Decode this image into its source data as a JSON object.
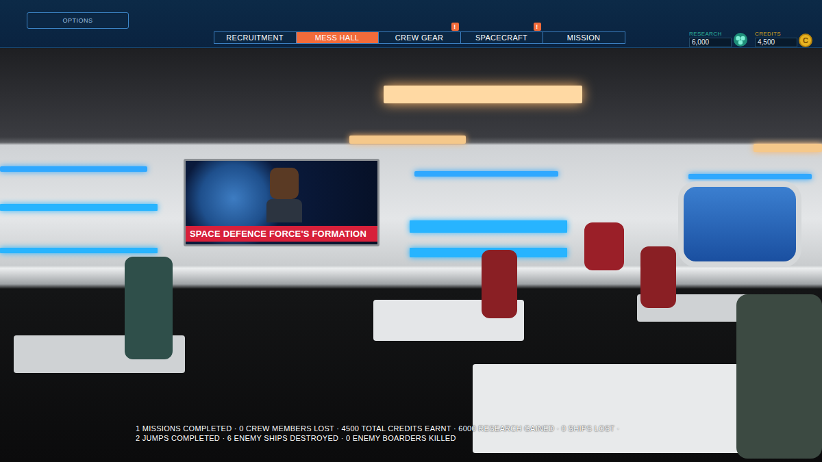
{
  "options_button": "OPTIONS",
  "tabs": [
    {
      "label": "RECRUITMENT",
      "selected": false,
      "badge": null
    },
    {
      "label": "MESS HALL",
      "selected": true,
      "badge": null
    },
    {
      "label": "CREW GEAR",
      "selected": false,
      "badge": "!"
    },
    {
      "label": "SPACECRAFT",
      "selected": false,
      "badge": "!"
    },
    {
      "label": "MISSION",
      "selected": false,
      "badge": null
    }
  ],
  "resources": [
    {
      "label": "RESEARCH",
      "value": "6,000",
      "kind": "research",
      "icon_text": null
    },
    {
      "label": "CREDITS",
      "value": "4,500",
      "kind": "credits",
      "icon_text": "C"
    }
  ],
  "news_ticker": "SPACE DEFENCE FORCE'S FORMATION",
  "stats": [
    "1 MISSIONS COMPLETED · 0 CREW MEMBERS LOST · 4500 TOTAL CREDITS EARNT · 6000 RESEARCH GAINED · 0 SHIPS LOST ·",
    "2 JUMPS COMPLETED · 6 ENEMY SHIPS DESTROYED · 0 ENEMY BOARDERS KILLED"
  ]
}
